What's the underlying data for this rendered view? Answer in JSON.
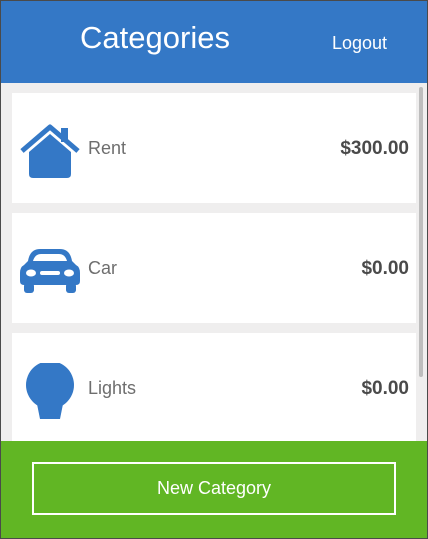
{
  "header": {
    "title": "Categories",
    "logout_label": "Logout"
  },
  "colors": {
    "header": "#3478c6",
    "footer": "#61b624",
    "icon": "#3478c6"
  },
  "categories": [
    {
      "icon": "house-icon",
      "name": "Rent",
      "amount": "$300.00"
    },
    {
      "icon": "car-icon",
      "name": "Car",
      "amount": "$0.00"
    },
    {
      "icon": "lightbulb-icon",
      "name": "Lights",
      "amount": "$0.00"
    }
  ],
  "footer": {
    "new_category_label": "New Category"
  }
}
